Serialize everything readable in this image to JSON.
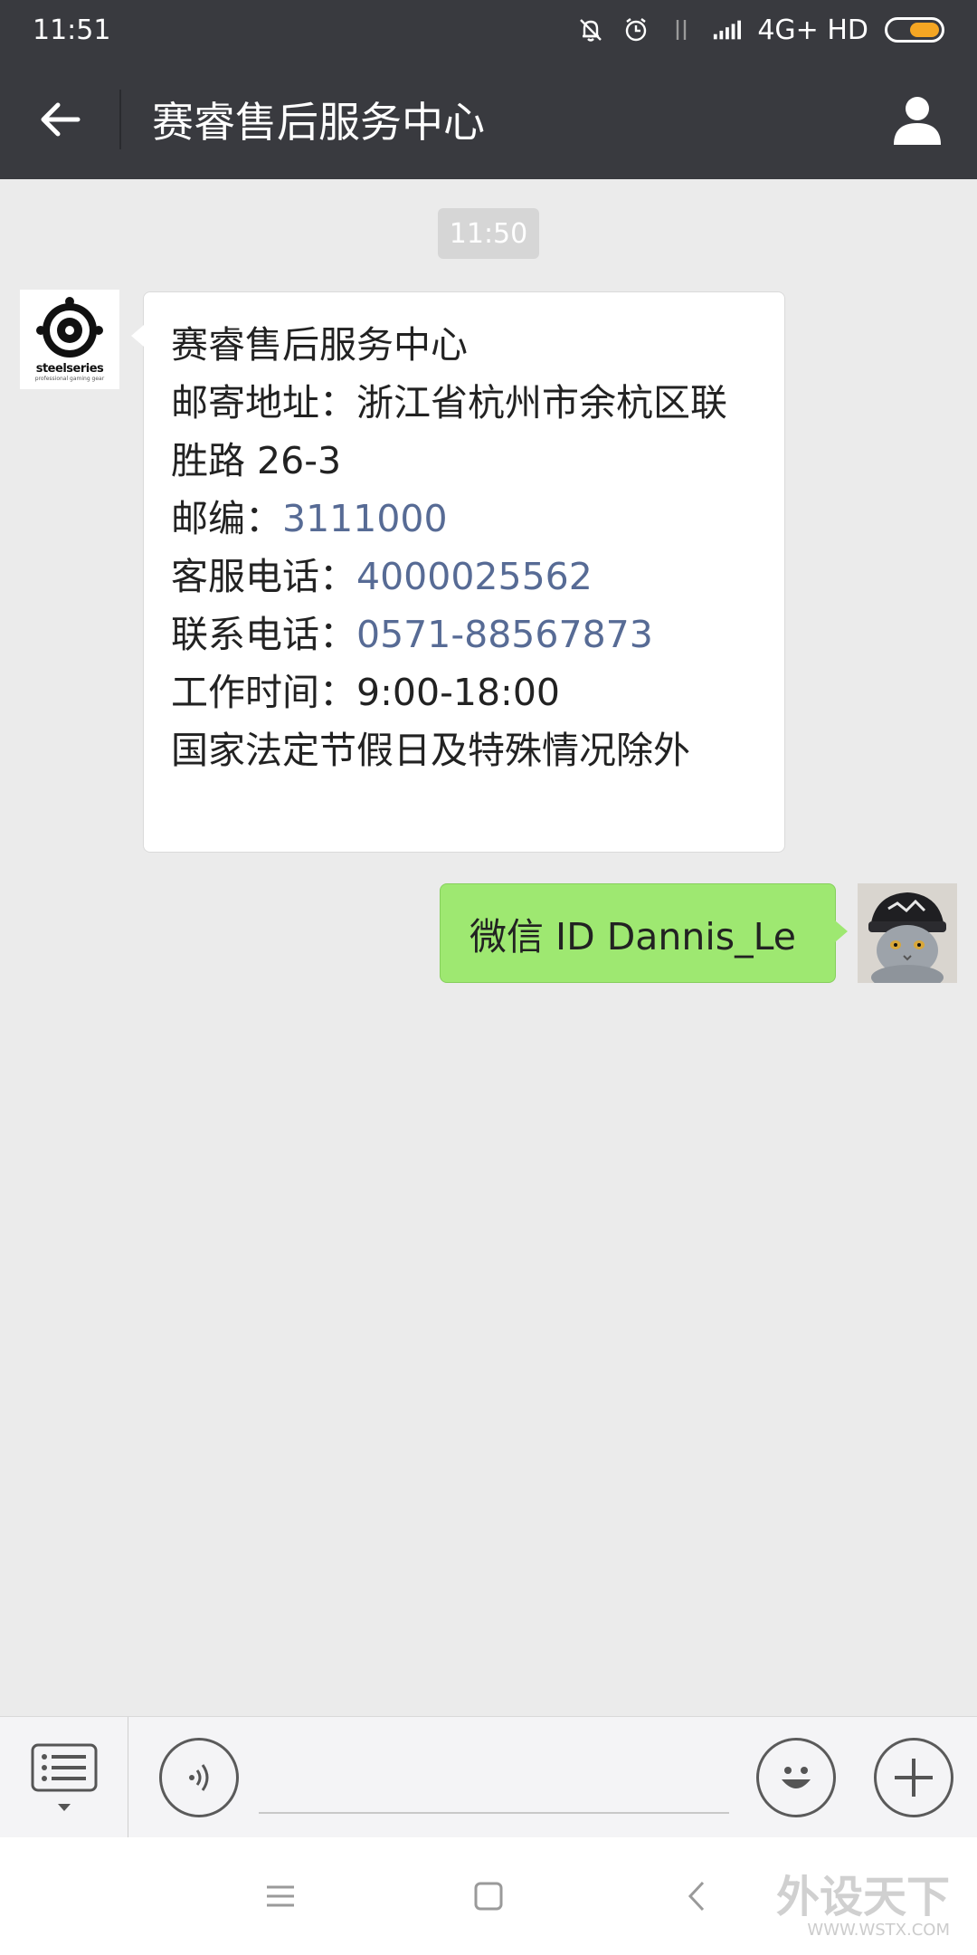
{
  "status_bar": {
    "time": "11:51",
    "network": "4G+ HD",
    "battery_color": "#f5a623"
  },
  "header": {
    "title": "赛睿售后服务中心"
  },
  "chat": {
    "timestamp": "11:50",
    "incoming": {
      "brand_text": "steelseries",
      "brand_sub": "professional gaming gear",
      "lines": {
        "name": "赛睿售后服务中心",
        "address_label": "邮寄地址：",
        "address_value": "浙江省杭州市余杭区联胜路 26-3",
        "zip_label": "邮编：",
        "zip_value": "3111000",
        "service_label": "客服电话：",
        "service_value": "4000025562",
        "contact_label": "联系电话：",
        "contact_value": "0571-88567873",
        "hours_label": "工作时间：",
        "hours_value": "9:00-18:00",
        "note": "国家法定节假日及特殊情况除外"
      }
    },
    "outgoing": {
      "text": "微信 ID Dannis_Le"
    }
  },
  "input_bar": {
    "value": "",
    "icons": [
      "menu-list-icon",
      "voice-icon",
      "emoji-icon",
      "plus-icon"
    ]
  },
  "nav_bar": {
    "icons": [
      "menu-icon",
      "home-icon",
      "back-icon"
    ]
  },
  "watermark": {
    "text": "外设天下",
    "sub": "WWW.WSTX.COM"
  },
  "colors": {
    "header_bg": "#393a3f",
    "chat_bg": "#ebebeb",
    "outgoing_bubble": "#9ee871",
    "link": "#576b95"
  }
}
